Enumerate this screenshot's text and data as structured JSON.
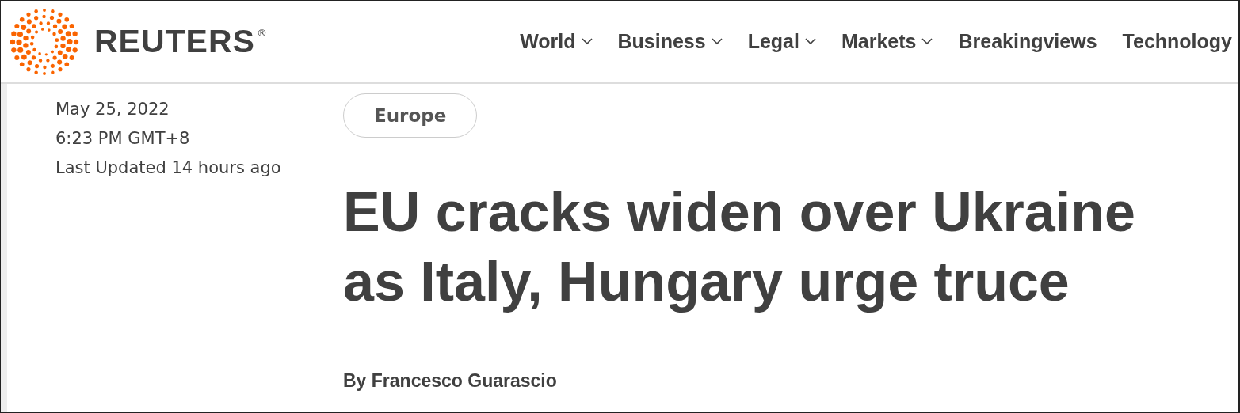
{
  "brand": {
    "name": "REUTERS",
    "mark": "®"
  },
  "nav": [
    {
      "label": "World",
      "dropdown": true
    },
    {
      "label": "Business",
      "dropdown": true
    },
    {
      "label": "Legal",
      "dropdown": true
    },
    {
      "label": "Markets",
      "dropdown": true
    },
    {
      "label": "Breakingviews",
      "dropdown": false
    },
    {
      "label": "Technology",
      "dropdown": false
    }
  ],
  "article": {
    "date": "May 25, 2022",
    "time": "6:23 PM GMT+8",
    "updated": "Last Updated 14 hours ago",
    "section": "Europe",
    "headline": "EU cracks widen over Ukraine as Italy, Hungary urge truce",
    "byline": "By Francesco Guarascio"
  }
}
